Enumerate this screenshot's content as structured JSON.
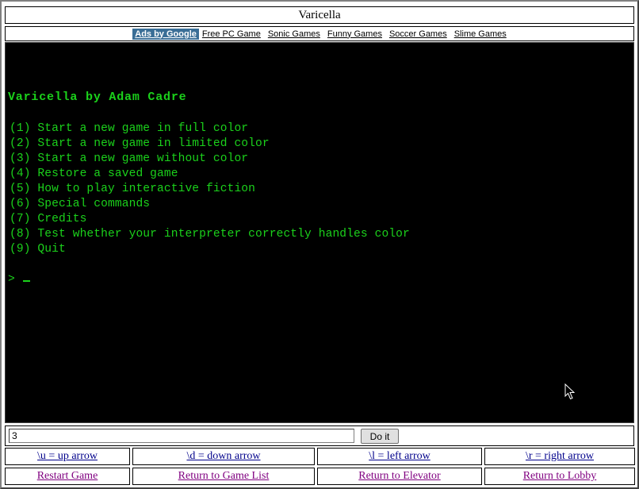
{
  "title": "Varicella",
  "ads": {
    "badge": "Ads by Google",
    "links": [
      "Free PC Game",
      "Sonic Games",
      "Funny Games",
      "Soccer Games",
      "Slime Games"
    ]
  },
  "game": {
    "heading": "Varicella by Adam Cadre",
    "menu": [
      "(1) Start a new game in full color",
      "(2) Start a new game in limited color",
      "(3) Start a new game without color",
      "(4) Restore a saved game",
      "(5) How to play interactive fiction",
      "(6) Special commands",
      "(7) Credits",
      "(8) Test whether your interpreter correctly handles color",
      "(9) Quit"
    ],
    "prompt": ">"
  },
  "command": {
    "value": "3",
    "button_label": "Do it"
  },
  "nav": {
    "arrows": [
      "\\u = up arrow",
      "\\d = down arrow",
      "\\l = left arrow",
      "\\r = right arrow"
    ],
    "links": [
      "Restart Game",
      "Return to Game List",
      "Return to Elevator",
      "Return to Lobby"
    ]
  },
  "colors": {
    "terminal_bg": "#000000",
    "terminal_text": "#1bd11b",
    "ad_badge": "#3a6e96",
    "link": "#00008b",
    "visited_link": "#800080"
  }
}
